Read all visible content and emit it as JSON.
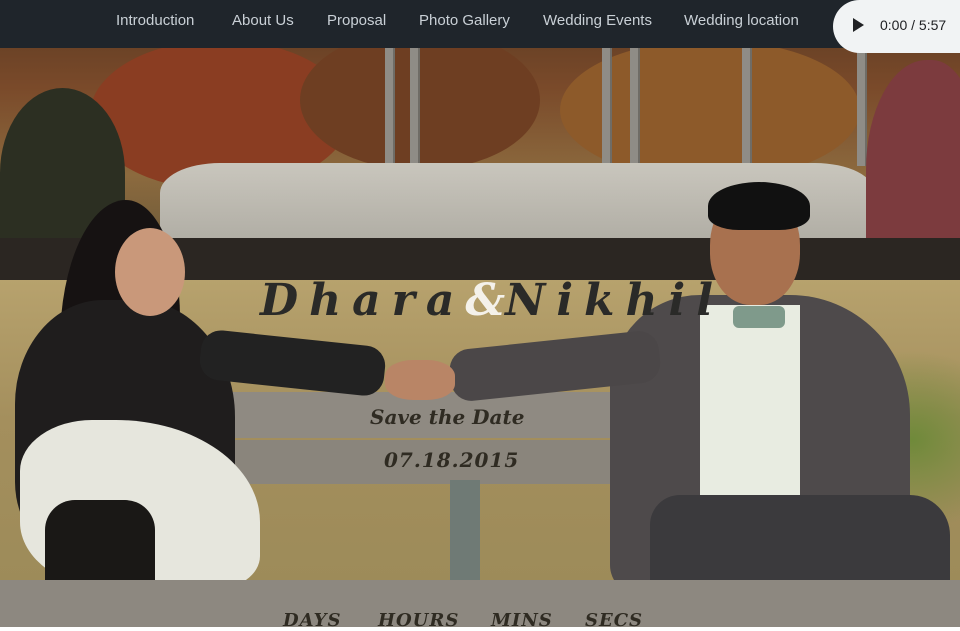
{
  "nav": {
    "items": [
      {
        "label": "Introduction"
      },
      {
        "label": "About Us"
      },
      {
        "label": "Proposal"
      },
      {
        "label": "Photo Gallery"
      },
      {
        "label": "Wedding Events"
      },
      {
        "label": "Wedding location"
      }
    ]
  },
  "audio": {
    "time": "0:00 / 5:57",
    "play_icon": "play-icon"
  },
  "hero": {
    "name_left": "Dhara",
    "ampersand": "&",
    "name_right": "Nikhil",
    "save_the_date": "Save the Date",
    "date": "07.18.2015",
    "countdown": {
      "days": "DAYS",
      "hours": "HOURS",
      "mins": "MINS",
      "secs": "SECS"
    }
  },
  "colors": {
    "navbar_bg": "#1f252b",
    "nav_text": "#c9d0d6",
    "overlay_text": "#2f2b22",
    "ampersand": "#f4f1ea"
  }
}
